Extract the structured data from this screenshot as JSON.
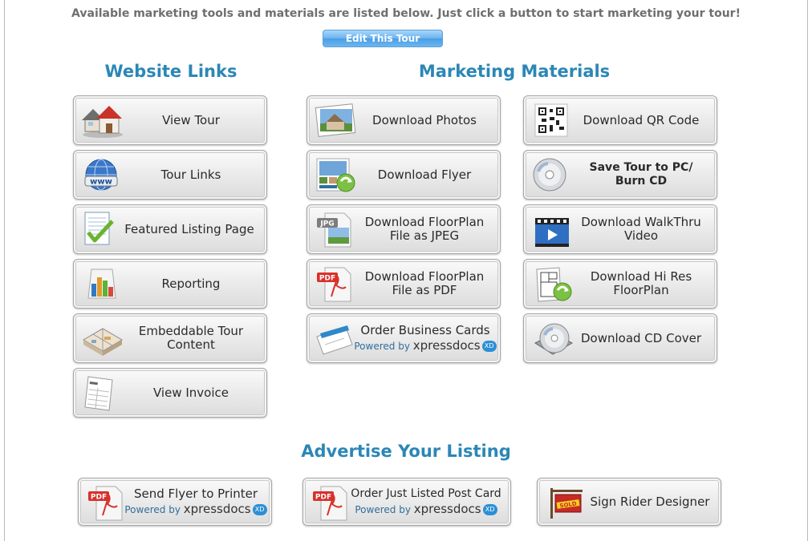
{
  "intro_text": "Available marketing tools and materials are listed below. Just click a button to start marketing your tour!",
  "edit_button": "Edit This Tour",
  "sections": {
    "website_links": "Website Links",
    "marketing_materials": "Marketing Materials",
    "advertise": "Advertise Your Listing"
  },
  "website_links": [
    {
      "label": "View Tour",
      "icon": "house-icon"
    },
    {
      "label": "Tour Links",
      "icon": "globe-www-icon"
    },
    {
      "label": "Featured Listing Page",
      "icon": "checklist-icon"
    },
    {
      "label": "Reporting",
      "icon": "bar-chart-icon"
    },
    {
      "line1": "Embeddable Tour",
      "line2": "Content",
      "icon": "floorplan-3d-icon"
    },
    {
      "label": "View Invoice",
      "icon": "invoice-icon"
    }
  ],
  "materials_left": [
    {
      "label": "Download Photos",
      "icon": "photo-icon"
    },
    {
      "label": "Download Flyer",
      "icon": "flyer-icon"
    },
    {
      "line1": "Download FloorPlan",
      "line2": "File as JPEG",
      "icon": "jpg-file-icon",
      "badge": "JPG"
    },
    {
      "line1": "Download FloorPlan",
      "line2": "File as PDF",
      "icon": "pdf-file-icon",
      "badge": "PDF"
    },
    {
      "label": "Order Business Cards",
      "powered": "Powered by",
      "brand": "xpressdocs",
      "xd": "XD",
      "icon": "business-cards-icon"
    }
  ],
  "materials_right": [
    {
      "label": "Download QR Code",
      "icon": "qr-code-icon"
    },
    {
      "line1": "Save Tour to PC/",
      "line2": "Burn CD",
      "icon": "cd-icon"
    },
    {
      "line1": "Download WalkThru",
      "line2": "Video",
      "icon": "video-icon"
    },
    {
      "line1": "Download Hi Res",
      "line2": "FloorPlan",
      "icon": "floorplan-download-icon"
    },
    {
      "label": "Download CD Cover",
      "icon": "cd-cover-icon"
    }
  ],
  "advertise": [
    {
      "label": "Send Flyer to Printer",
      "powered": "Powered by",
      "brand": "xpressdocs",
      "xd": "XD",
      "icon": "pdf-file-icon",
      "badge": "PDF"
    },
    {
      "label": "Order Just Listed Post Card",
      "powered": "Powered by",
      "brand": "xpressdocs",
      "xd": "XD",
      "icon": "pdf-file-icon",
      "badge": "PDF"
    },
    {
      "label": "Sign Rider Designer",
      "icon": "sold-sign-icon",
      "badge": "SOLD"
    }
  ],
  "colors": {
    "accent": "#2b87b6",
    "button_blue": "#6ab3ef",
    "pdf_red": "#d9302b"
  }
}
